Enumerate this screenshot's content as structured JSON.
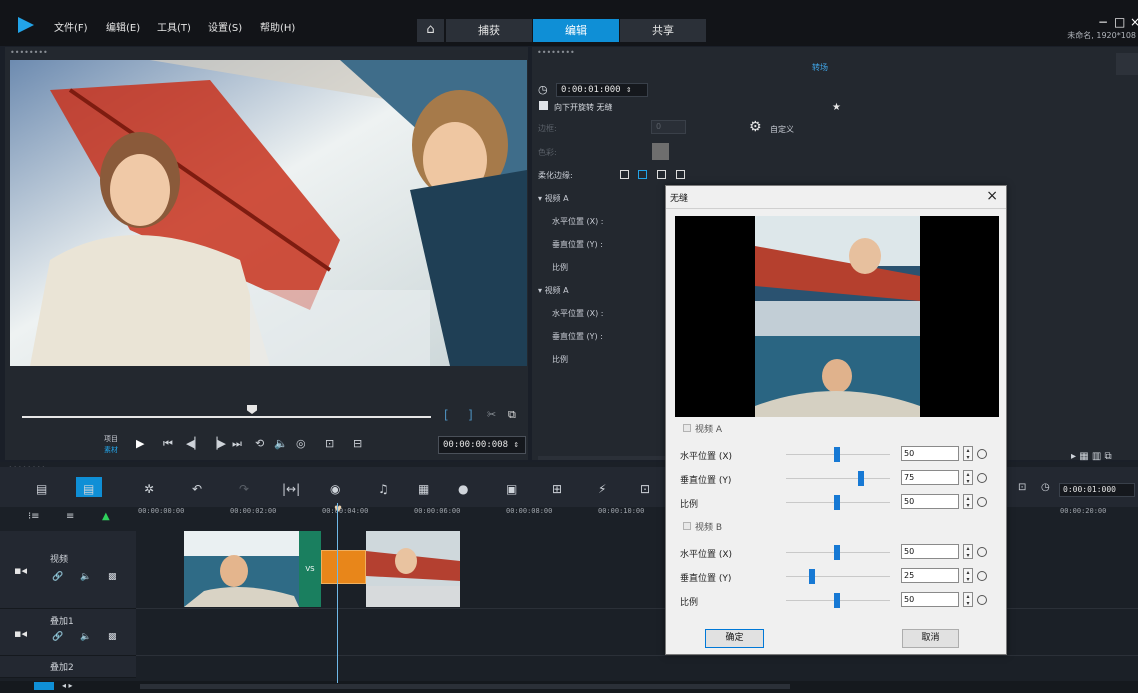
{
  "menu": {
    "file": "文件(F)",
    "edit": "编辑(E)",
    "tools": "工具(T)",
    "settings": "设置(S)",
    "help": "帮助(H)"
  },
  "tabs": {
    "capture": "捕获",
    "edit": "编辑",
    "share": "共享"
  },
  "window": {
    "project_info": "未命名, 1920*108"
  },
  "preview": {
    "project_mode": "项目",
    "clip_mode": "素材",
    "timecode": "00:00:00:008"
  },
  "edit_panel": {
    "title": "转场",
    "duration": "0:00:01:000",
    "transition_name": "向下开旋转 无缝",
    "border_label": "边框:",
    "border_value": "0",
    "color_label": "色彩:",
    "custom_label": "自定义",
    "soft_edge_label": "柔化边缘:",
    "video_a_1": "视频 A",
    "h_pos_1": "水平位置 (X) :",
    "v_pos_1": "垂直位置 (Y) :",
    "scale_1": "比例",
    "video_a_2": "视频 A",
    "h_pos_2": "水平位置 (X) :",
    "v_pos_2": "垂直位置 (Y) :",
    "scale_2": "比例"
  },
  "timeline": {
    "ruler": [
      "00:00:00:00",
      "00:00:02:00",
      "00:00:04:00",
      "00:00:06:00",
      "00:00:08:00",
      "00:00:10:00",
      "00:00:20:00"
    ],
    "right_timecode": "0:00:01:000",
    "tracks": [
      {
        "name": "视频"
      },
      {
        "name": "叠加1"
      },
      {
        "name": "叠加2"
      }
    ],
    "transition_mark": "VS"
  },
  "dialog": {
    "title": "无缝",
    "video_a_label": "视频 A",
    "video_b_label": "视频 B",
    "h_label_a": "水平位置 (X)",
    "v_label_a": "垂直位置 (Y)",
    "scale_label_a": "比例",
    "h_label_b": "水平位置 (X)",
    "v_label_b": "垂直位置 (Y)",
    "scale_label_b": "比例",
    "a_h_value": "50",
    "a_v_value": "75",
    "a_scale_value": "50",
    "b_h_value": "50",
    "b_v_value": "25",
    "b_scale_value": "50",
    "ok": "确定",
    "cancel": "取消"
  },
  "icons": [
    "logo-icon",
    "home-icon",
    "play-icon",
    "clock-icon",
    "gear-icon",
    "close-icon",
    "speaker-icon",
    "camera-icon",
    "link-icon",
    "reset-icon"
  ],
  "colors": {
    "accent": "#0f8fd6",
    "transition_green": "#1a7f5f",
    "clip_orange": "#e8861a"
  }
}
